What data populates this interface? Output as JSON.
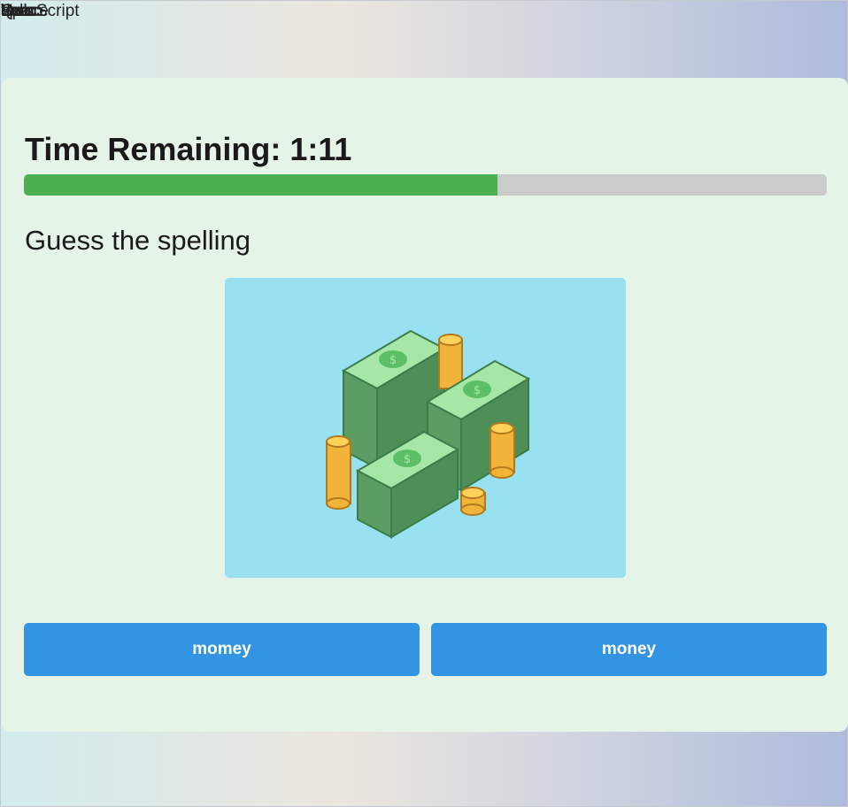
{
  "overlap_text": [
    "Script",
    "spec",
    "Space",
    "Vue",
    "test",
    "demo",
    "hello",
    "Quiz"
  ],
  "quiz": {
    "timer_label": "Time Remaining: 1:11",
    "progress_fraction": 0.59,
    "prompt": "Guess the spelling",
    "image_icon": "money-stack-icon",
    "choices": [
      "momey",
      "money"
    ]
  },
  "colors": {
    "card": "#e6f4e7",
    "progress_fill": "#4caf50",
    "progress_track": "#cbcbcb",
    "image_bg": "#98e1f1",
    "button": "#3394e3"
  }
}
